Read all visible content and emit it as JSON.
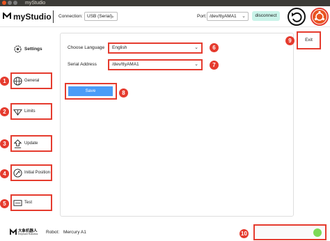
{
  "window": {
    "title": "myStudio"
  },
  "header": {
    "app_name": "myStudio",
    "connection_label": "Connection:",
    "connection_value": "USB (Serial)",
    "port_label": "Port:",
    "port_value": "/dev/ttyAMA1",
    "disconnect_label": "disconnect"
  },
  "sidebar": {
    "title": "Settings",
    "items": [
      {
        "label": "General",
        "badge": "1"
      },
      {
        "label": "Limits",
        "badge": "2"
      },
      {
        "label": "Update",
        "badge": "3"
      },
      {
        "label": "Initial Position",
        "badge": "4"
      },
      {
        "label": "Test",
        "badge": "5"
      }
    ]
  },
  "form": {
    "language_label": "Choose Language",
    "language_value": "English",
    "language_badge": "6",
    "serial_label": "Serial Address",
    "serial_value": "/dev/ttyAMA1",
    "serial_badge": "7",
    "save_label": "Save",
    "save_badge": "8"
  },
  "exit": {
    "label": "Exit",
    "badge": "9"
  },
  "footer": {
    "brand_cn": "大象机器人",
    "brand_en": "Elephant Robotics",
    "robot_label": "Robot:",
    "robot_value": "Mercury A1",
    "status_badge": "10"
  },
  "colors": {
    "annotation_red": "#e53b2e",
    "save_blue": "#4a9cf7",
    "status_green": "#7ed957",
    "disconnect_bg": "#c9f3e9"
  }
}
